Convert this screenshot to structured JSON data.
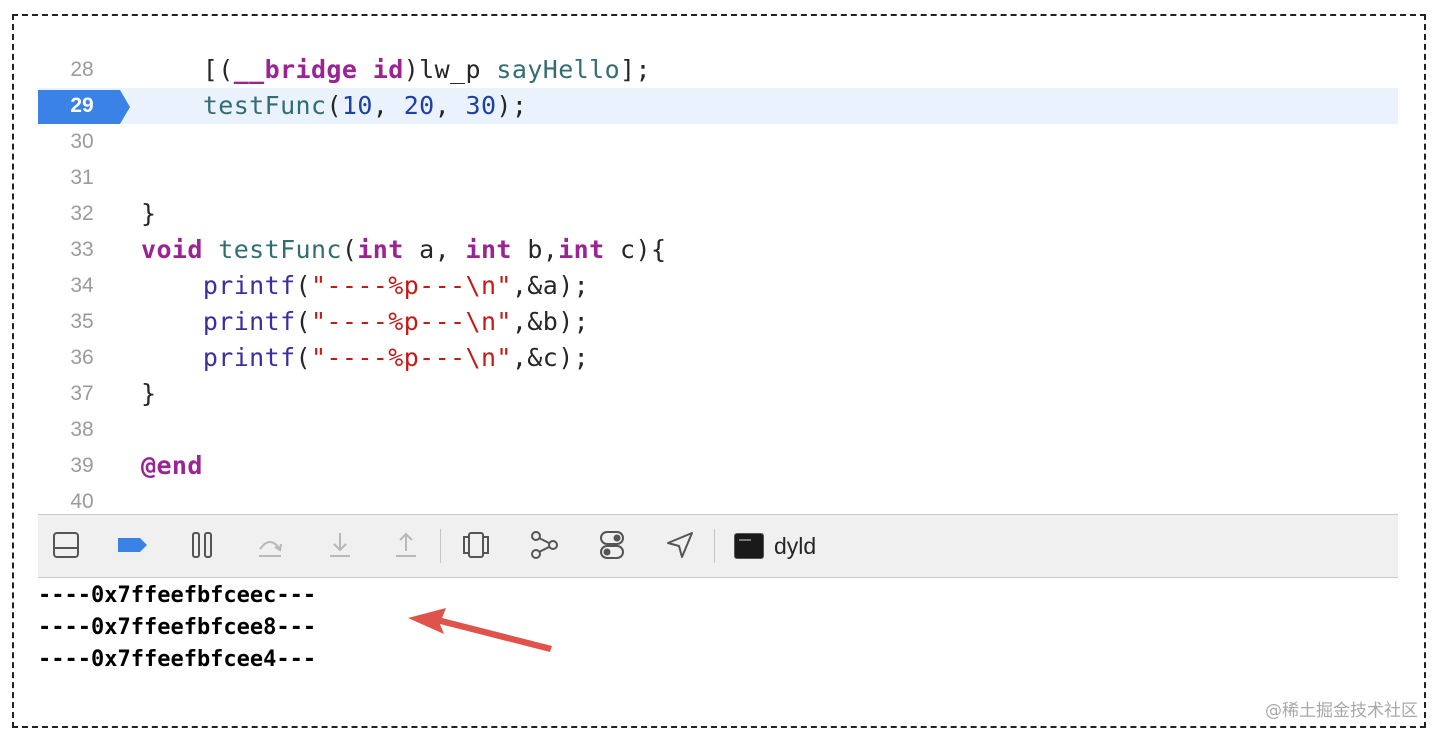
{
  "editor": {
    "current_line": "29",
    "lines": [
      {
        "num": "28",
        "tokens": [
          [
            "pl",
            "    [("
          ],
          [
            "kw",
            "__bridge"
          ],
          [
            "pl",
            " "
          ],
          [
            "kw",
            "id"
          ],
          [
            "pl",
            ")lw_p "
          ],
          [
            "fn",
            "sayHello"
          ],
          [
            "pl",
            "];"
          ]
        ]
      },
      {
        "num": "29",
        "tokens": [
          [
            "pl",
            "    "
          ],
          [
            "fn",
            "testFunc"
          ],
          [
            "pl",
            "("
          ],
          [
            "num",
            "10"
          ],
          [
            "pl",
            ", "
          ],
          [
            "num",
            "20"
          ],
          [
            "pl",
            ", "
          ],
          [
            "num",
            "30"
          ],
          [
            "pl",
            ");"
          ]
        ]
      },
      {
        "num": "30",
        "tokens": []
      },
      {
        "num": "31",
        "tokens": []
      },
      {
        "num": "32",
        "tokens": [
          [
            "pl",
            "}"
          ]
        ]
      },
      {
        "num": "33",
        "tokens": [
          [
            "kw",
            "void"
          ],
          [
            "pl",
            " "
          ],
          [
            "fn",
            "testFunc"
          ],
          [
            "pl",
            "("
          ],
          [
            "kw",
            "int"
          ],
          [
            "pl",
            " a, "
          ],
          [
            "kw",
            "int"
          ],
          [
            "pl",
            " b,"
          ],
          [
            "kw",
            "int"
          ],
          [
            "pl",
            " c){"
          ]
        ]
      },
      {
        "num": "34",
        "tokens": [
          [
            "pl",
            "    "
          ],
          [
            "mc",
            "printf"
          ],
          [
            "pl",
            "("
          ],
          [
            "str",
            "\"----%p---\\n\""
          ],
          [
            "pl",
            ",&a);"
          ]
        ]
      },
      {
        "num": "35",
        "tokens": [
          [
            "pl",
            "    "
          ],
          [
            "mc",
            "printf"
          ],
          [
            "pl",
            "("
          ],
          [
            "str",
            "\"----%p---\\n\""
          ],
          [
            "pl",
            ",&b);"
          ]
        ]
      },
      {
        "num": "36",
        "tokens": [
          [
            "pl",
            "    "
          ],
          [
            "mc",
            "printf"
          ],
          [
            "pl",
            "("
          ],
          [
            "str",
            "\"----%p---\\n\""
          ],
          [
            "pl",
            ",&c);"
          ]
        ]
      },
      {
        "num": "37",
        "tokens": [
          [
            "pl",
            "}"
          ]
        ]
      },
      {
        "num": "38",
        "tokens": []
      },
      {
        "num": "39",
        "tokens": [
          [
            "kw",
            "@end"
          ]
        ]
      },
      {
        "num": "40",
        "tokens": []
      }
    ]
  },
  "debug_toolbar": {
    "icons": [
      {
        "name": "hide-debug-area-icon",
        "enabled": true
      },
      {
        "name": "breakpoints-toggle-icon",
        "enabled": true,
        "active": true
      },
      {
        "name": "pause-continue-icon",
        "enabled": true
      },
      {
        "name": "step-over-icon",
        "enabled": false
      },
      {
        "name": "step-into-icon",
        "enabled": false
      },
      {
        "name": "step-out-icon",
        "enabled": false
      },
      {
        "name": "view-hierarchy-icon",
        "enabled": true
      },
      {
        "name": "memory-graph-icon",
        "enabled": true
      },
      {
        "name": "environment-overrides-icon",
        "enabled": true
      },
      {
        "name": "simulate-location-icon",
        "enabled": true
      }
    ],
    "process_name": "dyld"
  },
  "console": {
    "output": [
      "----0x7ffeefbfceec---",
      "----0x7ffeefbfcee8---",
      "----0x7ffeefbfcee4---"
    ]
  },
  "annotation": {
    "arrow_color": "#e0534a"
  },
  "watermark": "@稀土掘金技术社区",
  "colors": {
    "keyword": "#9b2393",
    "function": "#326d74",
    "macro": "#3b2ea0",
    "number": "#1c3fa8",
    "string": "#c41a16",
    "breakpoint": "#3b82e6",
    "current_line_bg": "#eaf2fd"
  }
}
